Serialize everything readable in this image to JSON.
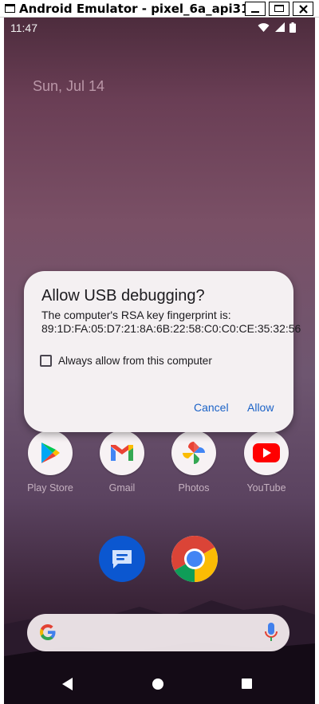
{
  "window": {
    "title": "Android Emulator - pixel_6a_api31..."
  },
  "status_bar": {
    "time": "11:47",
    "icons": [
      "wifi-icon",
      "signal-icon",
      "battery-icon"
    ]
  },
  "home": {
    "date": "Sun, Jul 14",
    "apps": [
      {
        "label": "Play Store",
        "icon": "play-store-icon"
      },
      {
        "label": "Gmail",
        "icon": "gmail-icon"
      },
      {
        "label": "Photos",
        "icon": "photos-icon"
      },
      {
        "label": "YouTube",
        "icon": "youtube-icon"
      }
    ],
    "dock": [
      {
        "icon": "messages-icon"
      },
      {
        "icon": "chrome-icon"
      }
    ]
  },
  "dialog": {
    "title": "Allow USB debugging?",
    "message": "The computer's RSA key fingerprint is: 89:1D:FA:05:D7:21:8A:6B:22:58:C0:C0:CE:35:32:56",
    "checkbox_label": "Always allow from this computer",
    "checkbox_checked": false,
    "cancel_label": "Cancel",
    "allow_label": "Allow",
    "accent_color": "#1a62c7"
  }
}
